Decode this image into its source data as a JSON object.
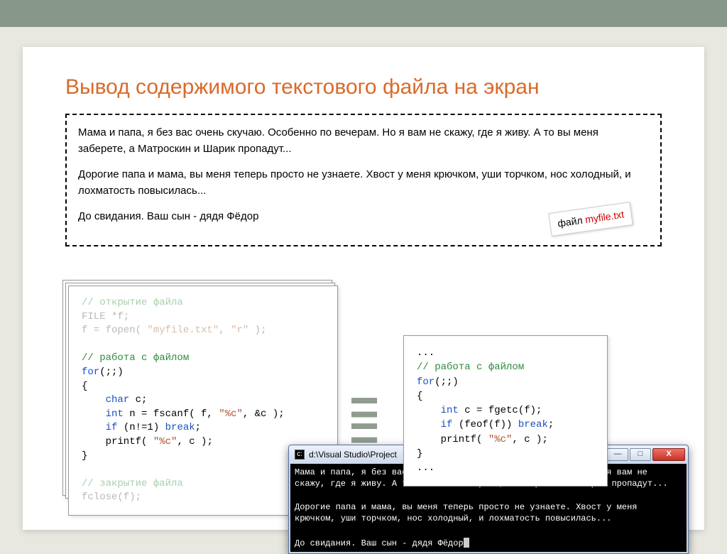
{
  "title": "Вывод содержимого текстового файла на экран",
  "filebox": {
    "p1": "Мама и папа, я без вас очень скучаю. Особенно по вечерам. Но я вам не скажу, где я живу. А то вы меня заберете, а Матроскин и Шарик пропадут...",
    "p2": "Дорогие папа и мама, вы меня теперь просто не узнаете. Хвост у меня крючком, уши торчком, нос холодный, и лохматость повысилась...",
    "p3": "До свидания. Ваш сын - дядя Фёдор",
    "label_prefix": "файл ",
    "label_name": "myfile.txt"
  },
  "code1": {
    "c1": "// открытие файла",
    "l2": "FILE *f;",
    "l3a": "f = fopen( ",
    "l3s": "\"myfile.txt\"",
    "l3b": ", ",
    "l3s2": "\"r\"",
    "l3c": " );",
    "c2": "// работа с файлом",
    "kw1": "for",
    "l5": "(;;)",
    "l6": "{",
    "kw2": "    char",
    "l7": " c;",
    "kw3": "    int",
    "l8a": " n = fscanf( f, ",
    "s1": "\"%c\"",
    "l8b": ", &c );",
    "kw4": "    if",
    "l9a": " (n!=1) ",
    "kw5": "break",
    "l9b": ";",
    "l10a": "    printf( ",
    "s2": "\"%c\"",
    "l10b": ", c );",
    "l11": "}",
    "c3": "// закрытие файла",
    "l12": "fclose(f);"
  },
  "equals": "=",
  "code2": {
    "dots": "...",
    "c1": "// работа с файлом",
    "kw1": "for",
    "l1": "(;;)",
    "l2": "{",
    "kw2": "    int",
    "l3": " c = fgetc(f);",
    "kw3": "    if",
    "l4a": " (feof(f)) ",
    "kw4": "break",
    "l4b": ";",
    "l5a": "    printf( ",
    "s1": "\"%c\"",
    "l5b": ", c );",
    "l6": "}",
    "dots2": "..."
  },
  "console": {
    "title": "d:\\Visual Studio\\Project",
    "min": "—",
    "max": "□",
    "close": "X",
    "body": "Мама и папа, я без вас очень скучаю. Особенно по вечерам. Но я вам не скажу, где я живу. А то вы меня заберете, а Матроскин и Шарик пропадут...\n\nДорогие папа и мама, вы меня теперь просто не узнаете. Хвост у меня крючком, уши торчком, нос холодный, и лохматость повысилась...\n\nДо свидания. Ваш сын - дядя Фёдор"
  }
}
